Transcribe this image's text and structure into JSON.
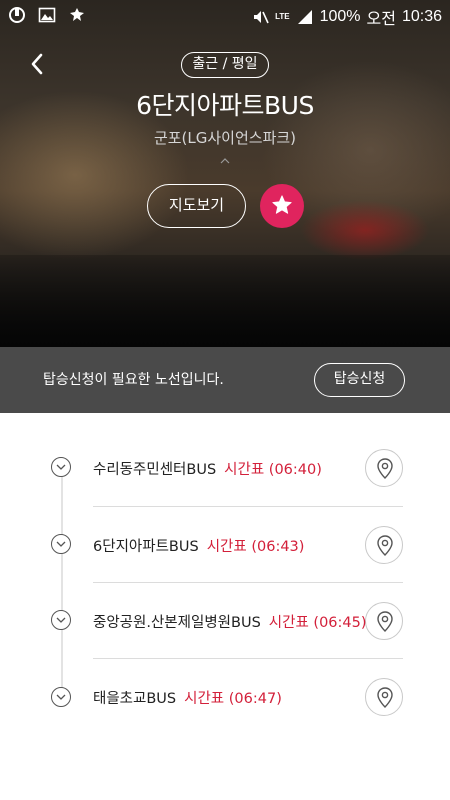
{
  "status_bar": {
    "battery": "100%",
    "ampm": "오전",
    "time": "10:36",
    "network": "LTE"
  },
  "header": {
    "badge": "출근 / 평일",
    "title": "6단지아파트BUS",
    "subtitle": "군포(LG사이언스파크)",
    "map_button": "지도보기"
  },
  "notice": {
    "message": "탑승신청이 필요한 노선입니다.",
    "apply_button": "탑승신청"
  },
  "stops": [
    {
      "name": "수리동주민센터BUS",
      "timetable": "시간표 (06:40)"
    },
    {
      "name": "6단지아파트BUS",
      "timetable": "시간표 (06:43)"
    },
    {
      "name": "중앙공원.산본제일병원BUS",
      "timetable": "시간표 (06:45)"
    },
    {
      "name": "태을초교BUS",
      "timetable": "시간표 (06:47)"
    }
  ],
  "colors": {
    "accent": "#e0245e",
    "time_text": "#d3203a",
    "notice_bg": "#4a4a4a"
  }
}
